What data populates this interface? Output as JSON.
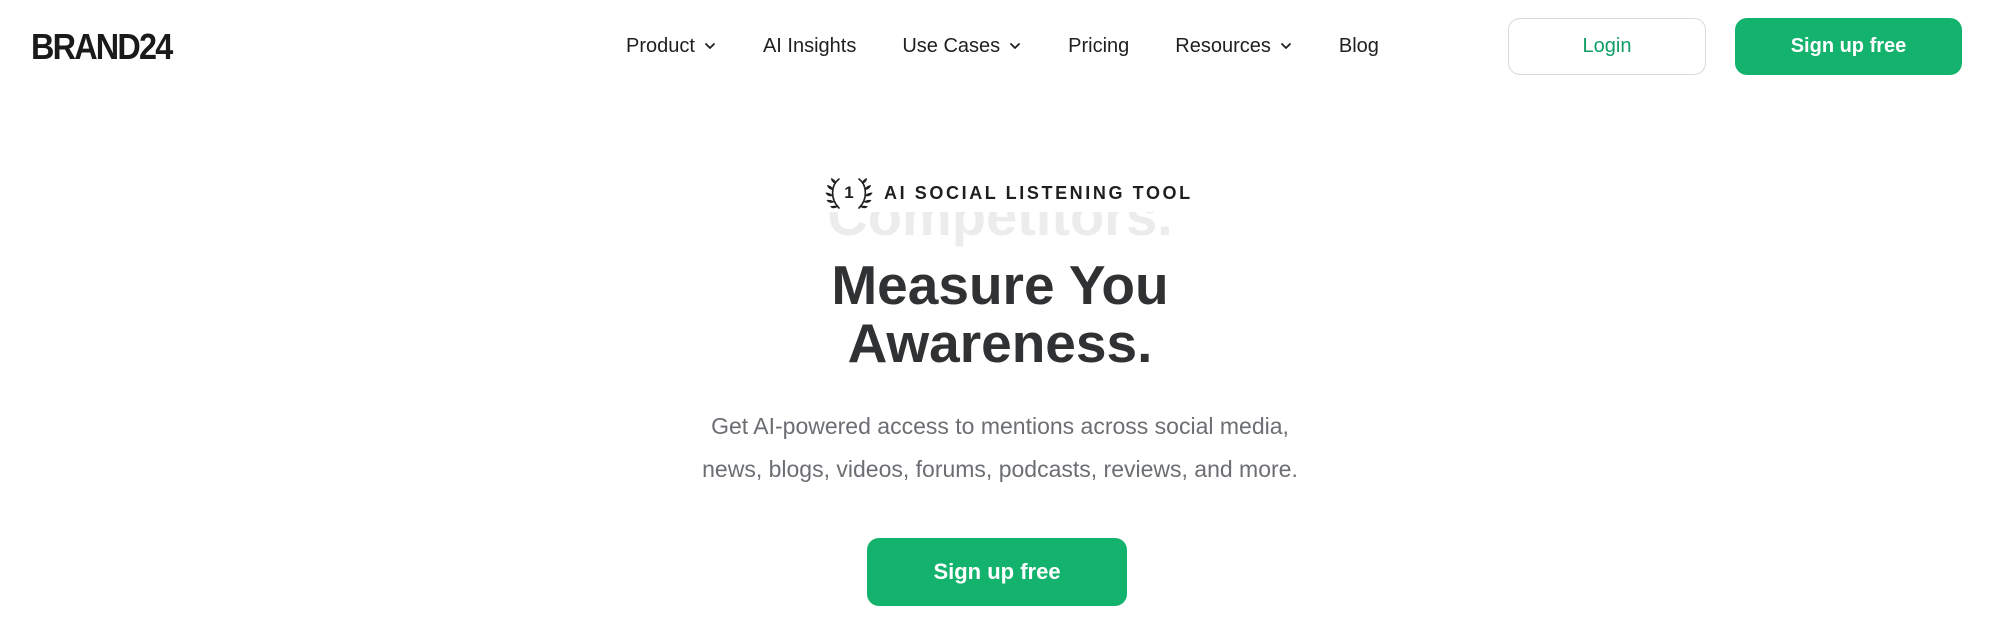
{
  "header": {
    "logo": "BRAND24",
    "nav": [
      {
        "label": "Product",
        "has_dropdown": true
      },
      {
        "label": "AI Insights",
        "has_dropdown": false
      },
      {
        "label": "Use Cases",
        "has_dropdown": true
      },
      {
        "label": "Pricing",
        "has_dropdown": false
      },
      {
        "label": "Resources",
        "has_dropdown": true
      },
      {
        "label": "Blog",
        "has_dropdown": false
      }
    ],
    "login_label": "Login",
    "signup_label": "Sign up free"
  },
  "hero": {
    "badge": {
      "icon": "laurel-rank-1-icon",
      "rank": "1",
      "text": "AI SOCIAL LISTENING TOOL"
    },
    "rotating_word_fading": "Competitors.",
    "headline_line1": "Measure You",
    "headline_line2": "Awareness.",
    "subtext_line1": "Get AI-powered access to mentions across social media,",
    "subtext_line2": "news, blogs, videos, forums, podcasts, reviews, and more.",
    "cta_label": "Sign up free"
  },
  "colors": {
    "brand_green": "#14b36d",
    "login_text": "#0f9d63",
    "headline": "#2f3133",
    "subtext": "#6b6e72"
  }
}
